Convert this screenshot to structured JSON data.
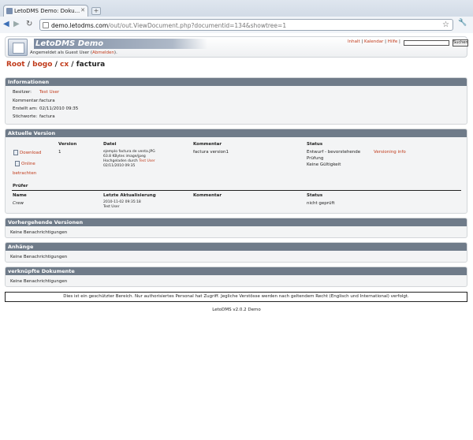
{
  "browser": {
    "tab_title": "LetoDMS Demo: Doku...",
    "url_host": "demo.letodms.com",
    "url_path": "/out/out.ViewDocument.php?documentid=134&showtree=1"
  },
  "header": {
    "app_title": "LetoDMS Demo",
    "login_prefix": "Angemeldet als Guest User (",
    "logout": "Abmelden",
    "login_suffix": ").",
    "links": [
      "Inhalt",
      "Kalendar",
      "Hilfe"
    ],
    "search_button": "Suchen"
  },
  "breadcrumb": {
    "items": [
      "Root",
      "bogo",
      "cx"
    ],
    "sep": " / ",
    "current": "factura"
  },
  "info": {
    "title": "Informationen",
    "rows": [
      {
        "label": "Besitzer:",
        "value": "Test User"
      },
      {
        "label": "Kommentar:",
        "value": "factura"
      },
      {
        "label": "Erstellt am:",
        "value": "02/11/2010 09:35"
      },
      {
        "label": "Stichworte:",
        "value": "factura"
      }
    ]
  },
  "current": {
    "title": "Aktuelle Version",
    "headers": [
      "Version",
      "Datei",
      "Kommentar",
      "Status"
    ],
    "download": "Download",
    "online1": "Online",
    "online2": "betrachten",
    "version": "1",
    "file_lines": [
      "ejemplo factura de venta.JPG",
      "63.8 KBytes image/jpeg"
    ],
    "uploaded_prefix": "Hochgeladen durch ",
    "uploaded_by": "Test User",
    "uploaded_date": "02/11/2010 09:35",
    "comment": "factura version1",
    "status_lines": [
      "Entwurf - bevorstehende",
      "Prüfung",
      "Keine Gültigkeit"
    ],
    "version_info": "Versioning info",
    "reviewers_title": "Prüfer",
    "rev_headers": [
      "Name",
      "Letzte Aktualisierung",
      "Kommentar",
      "Status"
    ],
    "rev_name": "Crew",
    "rev_date": "2010-11-02 09:35:18",
    "rev_user": "Test User",
    "rev_status": "nicht geprüft"
  },
  "prev": {
    "title": "Vorhergehende Versionen",
    "text": "Keine Benachrichtigungen"
  },
  "attach": {
    "title": "Anhänge",
    "text": "Keine Benachrichtigungen"
  },
  "linked": {
    "title": "verknüpfte Dokumente",
    "text": "Keine Benachrichtigungen"
  },
  "notice": "Dies ist ein geschützter Bereich. Nur authorisiertes Personal hat Zugriff. Jegliche Verstösse werden nach geltendem Recht (Englisch und International) verfolgt.",
  "footer": "LetoDMS v2.0.2 Demo"
}
